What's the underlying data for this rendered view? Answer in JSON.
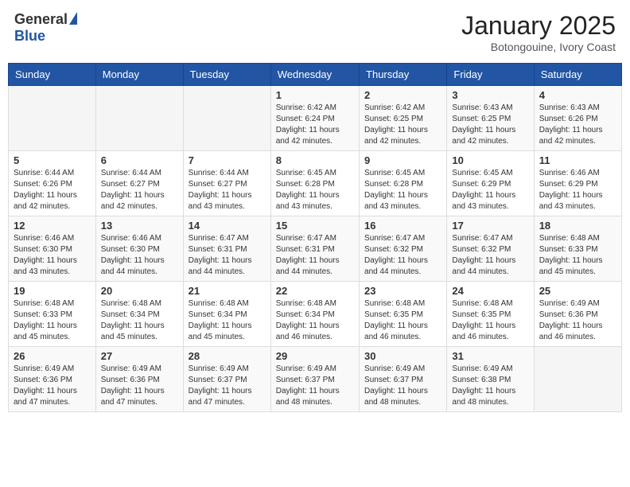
{
  "header": {
    "logo_general": "General",
    "logo_blue": "Blue",
    "title": "January 2025",
    "subtitle": "Botongouine, Ivory Coast"
  },
  "weekdays": [
    "Sunday",
    "Monday",
    "Tuesday",
    "Wednesday",
    "Thursday",
    "Friday",
    "Saturday"
  ],
  "weeks": [
    [
      {
        "day": "",
        "info": ""
      },
      {
        "day": "",
        "info": ""
      },
      {
        "day": "",
        "info": ""
      },
      {
        "day": "1",
        "info": "Sunrise: 6:42 AM\nSunset: 6:24 PM\nDaylight: 11 hours\nand 42 minutes."
      },
      {
        "day": "2",
        "info": "Sunrise: 6:42 AM\nSunset: 6:25 PM\nDaylight: 11 hours\nand 42 minutes."
      },
      {
        "day": "3",
        "info": "Sunrise: 6:43 AM\nSunset: 6:25 PM\nDaylight: 11 hours\nand 42 minutes."
      },
      {
        "day": "4",
        "info": "Sunrise: 6:43 AM\nSunset: 6:26 PM\nDaylight: 11 hours\nand 42 minutes."
      }
    ],
    [
      {
        "day": "5",
        "info": "Sunrise: 6:44 AM\nSunset: 6:26 PM\nDaylight: 11 hours\nand 42 minutes."
      },
      {
        "day": "6",
        "info": "Sunrise: 6:44 AM\nSunset: 6:27 PM\nDaylight: 11 hours\nand 42 minutes."
      },
      {
        "day": "7",
        "info": "Sunrise: 6:44 AM\nSunset: 6:27 PM\nDaylight: 11 hours\nand 43 minutes."
      },
      {
        "day": "8",
        "info": "Sunrise: 6:45 AM\nSunset: 6:28 PM\nDaylight: 11 hours\nand 43 minutes."
      },
      {
        "day": "9",
        "info": "Sunrise: 6:45 AM\nSunset: 6:28 PM\nDaylight: 11 hours\nand 43 minutes."
      },
      {
        "day": "10",
        "info": "Sunrise: 6:45 AM\nSunset: 6:29 PM\nDaylight: 11 hours\nand 43 minutes."
      },
      {
        "day": "11",
        "info": "Sunrise: 6:46 AM\nSunset: 6:29 PM\nDaylight: 11 hours\nand 43 minutes."
      }
    ],
    [
      {
        "day": "12",
        "info": "Sunrise: 6:46 AM\nSunset: 6:30 PM\nDaylight: 11 hours\nand 43 minutes."
      },
      {
        "day": "13",
        "info": "Sunrise: 6:46 AM\nSunset: 6:30 PM\nDaylight: 11 hours\nand 44 minutes."
      },
      {
        "day": "14",
        "info": "Sunrise: 6:47 AM\nSunset: 6:31 PM\nDaylight: 11 hours\nand 44 minutes."
      },
      {
        "day": "15",
        "info": "Sunrise: 6:47 AM\nSunset: 6:31 PM\nDaylight: 11 hours\nand 44 minutes."
      },
      {
        "day": "16",
        "info": "Sunrise: 6:47 AM\nSunset: 6:32 PM\nDaylight: 11 hours\nand 44 minutes."
      },
      {
        "day": "17",
        "info": "Sunrise: 6:47 AM\nSunset: 6:32 PM\nDaylight: 11 hours\nand 44 minutes."
      },
      {
        "day": "18",
        "info": "Sunrise: 6:48 AM\nSunset: 6:33 PM\nDaylight: 11 hours\nand 45 minutes."
      }
    ],
    [
      {
        "day": "19",
        "info": "Sunrise: 6:48 AM\nSunset: 6:33 PM\nDaylight: 11 hours\nand 45 minutes."
      },
      {
        "day": "20",
        "info": "Sunrise: 6:48 AM\nSunset: 6:34 PM\nDaylight: 11 hours\nand 45 minutes."
      },
      {
        "day": "21",
        "info": "Sunrise: 6:48 AM\nSunset: 6:34 PM\nDaylight: 11 hours\nand 45 minutes."
      },
      {
        "day": "22",
        "info": "Sunrise: 6:48 AM\nSunset: 6:34 PM\nDaylight: 11 hours\nand 46 minutes."
      },
      {
        "day": "23",
        "info": "Sunrise: 6:48 AM\nSunset: 6:35 PM\nDaylight: 11 hours\nand 46 minutes."
      },
      {
        "day": "24",
        "info": "Sunrise: 6:48 AM\nSunset: 6:35 PM\nDaylight: 11 hours\nand 46 minutes."
      },
      {
        "day": "25",
        "info": "Sunrise: 6:49 AM\nSunset: 6:36 PM\nDaylight: 11 hours\nand 46 minutes."
      }
    ],
    [
      {
        "day": "26",
        "info": "Sunrise: 6:49 AM\nSunset: 6:36 PM\nDaylight: 11 hours\nand 47 minutes."
      },
      {
        "day": "27",
        "info": "Sunrise: 6:49 AM\nSunset: 6:36 PM\nDaylight: 11 hours\nand 47 minutes."
      },
      {
        "day": "28",
        "info": "Sunrise: 6:49 AM\nSunset: 6:37 PM\nDaylight: 11 hours\nand 47 minutes."
      },
      {
        "day": "29",
        "info": "Sunrise: 6:49 AM\nSunset: 6:37 PM\nDaylight: 11 hours\nand 48 minutes."
      },
      {
        "day": "30",
        "info": "Sunrise: 6:49 AM\nSunset: 6:37 PM\nDaylight: 11 hours\nand 48 minutes."
      },
      {
        "day": "31",
        "info": "Sunrise: 6:49 AM\nSunset: 6:38 PM\nDaylight: 11 hours\nand 48 minutes."
      },
      {
        "day": "",
        "info": ""
      }
    ]
  ]
}
